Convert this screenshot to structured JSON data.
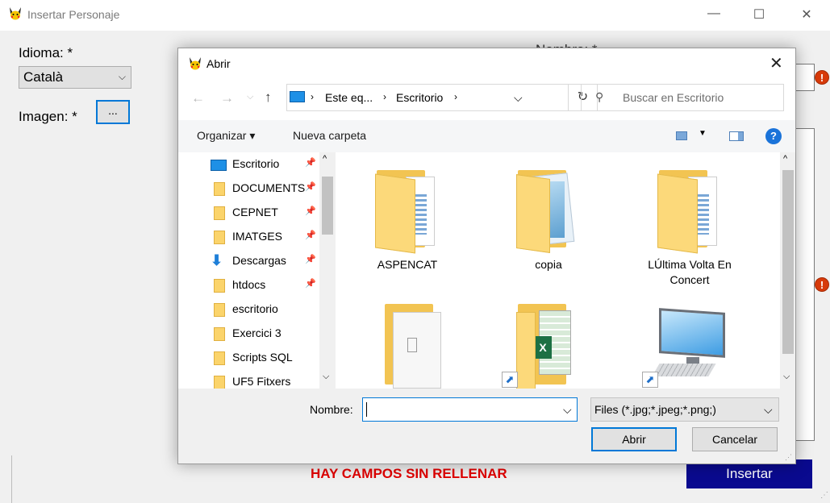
{
  "window": {
    "title": "Insertar Personaje",
    "minimize": "—",
    "maximize": "☐",
    "close": "✕"
  },
  "form": {
    "language_label": "Idioma: *",
    "language_value": "Català",
    "name_label_partial": "Nombre: *",
    "image_label": "Imagen: *",
    "image_button": "...",
    "error_mark": "!",
    "warning": "HAY CAMPOS SIN RELLENAR",
    "insert_button": "Insertar"
  },
  "dialog": {
    "title": "Abrir",
    "close": "✕",
    "breadcrumb": [
      "Este eq...",
      "Escritorio"
    ],
    "search_placeholder": "Buscar en Escritorio",
    "organize": "Organizar ▾",
    "new_folder": "Nueva carpeta",
    "help": "?",
    "nav_items": [
      {
        "label": "Escritorio",
        "pinned": true,
        "icon": "desktop-icon"
      },
      {
        "label": "DOCUMENTS",
        "pinned": true,
        "icon": "folder-icon"
      },
      {
        "label": "CEPNET",
        "pinned": true,
        "icon": "folder-icon"
      },
      {
        "label": "IMATGES",
        "pinned": true,
        "icon": "folder-icon"
      },
      {
        "label": "Descargas",
        "pinned": true,
        "icon": "download-icon"
      },
      {
        "label": "htdocs",
        "pinned": true,
        "icon": "folder-icon"
      },
      {
        "label": "escritorio",
        "pinned": false,
        "icon": "folder-icon"
      },
      {
        "label": "Exercici 3",
        "pinned": false,
        "icon": "folder-icon"
      },
      {
        "label": "Scripts SQL",
        "pinned": false,
        "icon": "folder-icon"
      },
      {
        "label": "UF5 Fitxers",
        "pinned": false,
        "icon": "folder-icon"
      }
    ],
    "files": [
      {
        "label": "ASPENCAT",
        "icon": "folder-docs-icon"
      },
      {
        "label": "copia",
        "icon": "folder-docs-icon"
      },
      {
        "label": "LÚltima Volta En Concert",
        "icon": "folder-docs-icon"
      },
      {
        "label": "",
        "icon": "folder-docs-icon"
      },
      {
        "label": "",
        "icon": "excel-shortcut-icon"
      },
      {
        "label": "",
        "icon": "computer-shortcut-icon"
      }
    ],
    "filename_label": "Nombre:",
    "filename_value": "",
    "filter_value": "Files (*.jpg;*.jpeg;*.png;)",
    "open_button": "Abrir",
    "cancel_button": "Cancelar"
  }
}
